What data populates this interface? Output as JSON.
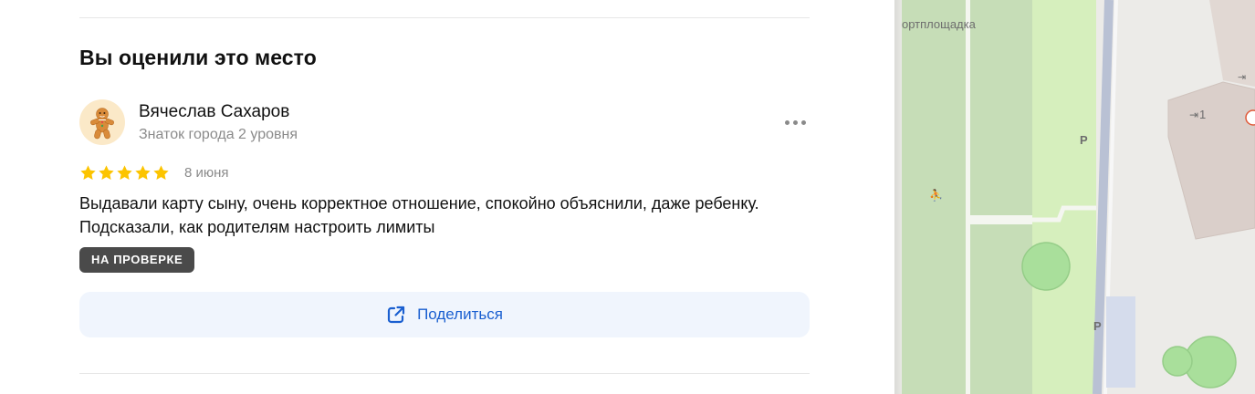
{
  "review_section": {
    "title": "Вы оценили это место"
  },
  "review": {
    "author_name": "Вячеслав Сахаров",
    "author_level": "Знаток города 2 уровня",
    "avatar_icon": "gingerbread-man-icon",
    "rating": 5,
    "max_rating": 5,
    "date": "8 июня",
    "text": "Выдавали карту сыну, очень корректное отношение, спокойно объяснили, даже ребенку. Подсказали, как родителям настроить лимиты",
    "status_badge": "НА ПРОВЕРКЕ",
    "more_icon": "more-horizontal-icon"
  },
  "share": {
    "label": "Поделиться",
    "icon": "share-external-icon"
  },
  "map": {
    "labels": {
      "sport_ground": "ортплощадка",
      "parking_1": "P",
      "parking_2": "P",
      "entrance_number": "1"
    }
  },
  "colors": {
    "accent": "#1a5fd0",
    "star": "#fcc400",
    "badge_bg": "#4a4a4a",
    "share_bg": "#f0f5fd",
    "map_green": "#c6ddb7",
    "map_road": "#b9c1d4"
  }
}
